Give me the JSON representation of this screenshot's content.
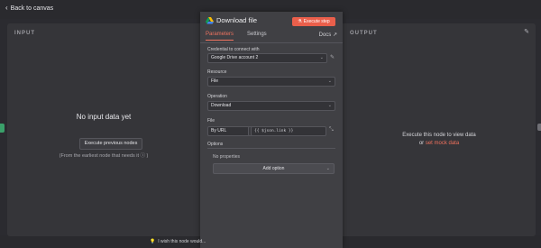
{
  "nav": {
    "back_label": "Back to canvas"
  },
  "input_pane": {
    "title": "INPUT",
    "empty_title": "No input data yet",
    "execute_previous_label": "Execute previous nodes",
    "earliest_note": "(From the earliest node that needs it ⓘ )"
  },
  "output_pane": {
    "title": "OUTPUT",
    "message_line1": "Execute this node to view data",
    "message_or": "or",
    "mock_link": "set mock data"
  },
  "node": {
    "title": "Download file",
    "execute_label": "Execute step",
    "tabs": [
      {
        "label": "Parameters",
        "active": true
      },
      {
        "label": "Settings",
        "active": false
      }
    ],
    "docs_label": "Docs",
    "credential": {
      "label": "Credential to connect with",
      "value": "Google Drive account 2"
    },
    "resource": {
      "label": "Resource",
      "value": "File"
    },
    "operation": {
      "label": "Operation",
      "value": "Download"
    },
    "file": {
      "label": "File",
      "mode": "By URL",
      "expression": "{{ $json.link }}"
    },
    "options": {
      "label": "Options",
      "empty": "No properties",
      "add_label": "Add option"
    },
    "feedback": "I wish this node would..."
  },
  "colors": {
    "accent": "#ea5f4b",
    "panel": "#404044",
    "background": "#2b2b30"
  }
}
